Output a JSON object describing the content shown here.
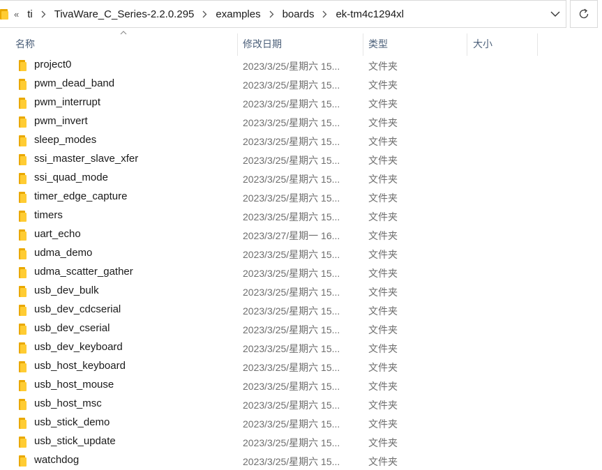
{
  "address_bar": {
    "overflow_label": "«",
    "crumbs": [
      "ti",
      "TivaWare_C_Series-2.2.0.295",
      "examples",
      "boards",
      "ek-tm4c1294xl"
    ]
  },
  "columns": {
    "name": "名称",
    "date": "修改日期",
    "type": "类型",
    "size": "大小"
  },
  "files": [
    {
      "name": "project0",
      "date": "2023/3/25/星期六 15...",
      "type": "文件夹"
    },
    {
      "name": "pwm_dead_band",
      "date": "2023/3/25/星期六 15...",
      "type": "文件夹"
    },
    {
      "name": "pwm_interrupt",
      "date": "2023/3/25/星期六 15...",
      "type": "文件夹"
    },
    {
      "name": "pwm_invert",
      "date": "2023/3/25/星期六 15...",
      "type": "文件夹"
    },
    {
      "name": "sleep_modes",
      "date": "2023/3/25/星期六 15...",
      "type": "文件夹"
    },
    {
      "name": "ssi_master_slave_xfer",
      "date": "2023/3/25/星期六 15...",
      "type": "文件夹"
    },
    {
      "name": "ssi_quad_mode",
      "date": "2023/3/25/星期六 15...",
      "type": "文件夹"
    },
    {
      "name": "timer_edge_capture",
      "date": "2023/3/25/星期六 15...",
      "type": "文件夹"
    },
    {
      "name": "timers",
      "date": "2023/3/25/星期六 15...",
      "type": "文件夹"
    },
    {
      "name": "uart_echo",
      "date": "2023/3/27/星期一 16...",
      "type": "文件夹"
    },
    {
      "name": "udma_demo",
      "date": "2023/3/25/星期六 15...",
      "type": "文件夹"
    },
    {
      "name": "udma_scatter_gather",
      "date": "2023/3/25/星期六 15...",
      "type": "文件夹"
    },
    {
      "name": "usb_dev_bulk",
      "date": "2023/3/25/星期六 15...",
      "type": "文件夹"
    },
    {
      "name": "usb_dev_cdcserial",
      "date": "2023/3/25/星期六 15...",
      "type": "文件夹"
    },
    {
      "name": "usb_dev_cserial",
      "date": "2023/3/25/星期六 15...",
      "type": "文件夹"
    },
    {
      "name": "usb_dev_keyboard",
      "date": "2023/3/25/星期六 15...",
      "type": "文件夹"
    },
    {
      "name": "usb_host_keyboard",
      "date": "2023/3/25/星期六 15...",
      "type": "文件夹"
    },
    {
      "name": "usb_host_mouse",
      "date": "2023/3/25/星期六 15...",
      "type": "文件夹"
    },
    {
      "name": "usb_host_msc",
      "date": "2023/3/25/星期六 15...",
      "type": "文件夹"
    },
    {
      "name": "usb_stick_demo",
      "date": "2023/3/25/星期六 15...",
      "type": "文件夹"
    },
    {
      "name": "usb_stick_update",
      "date": "2023/3/25/星期六 15...",
      "type": "文件夹"
    },
    {
      "name": "watchdog",
      "date": "2023/3/25/星期六 15...",
      "type": "文件夹"
    }
  ]
}
